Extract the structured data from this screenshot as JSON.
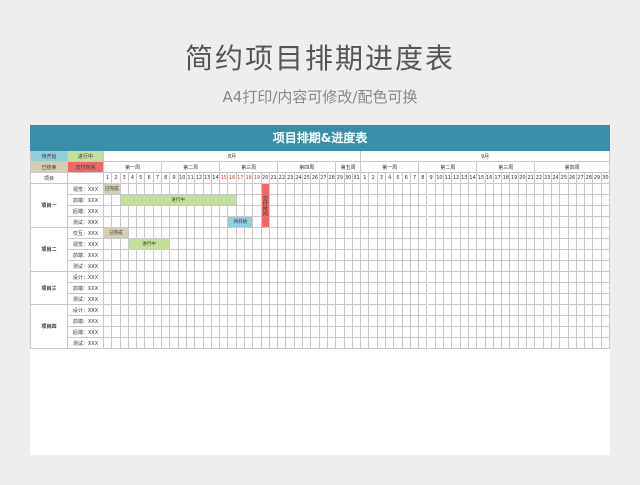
{
  "page": {
    "title": "简约项目排期进度表",
    "subtitle": "A4打印/内容可修改/配色可换"
  },
  "sheet": {
    "title": "项目排期&进度表",
    "colors": {
      "header": "#3a8fa8",
      "pending": "#92cddc",
      "in_progress": "#c4df9b",
      "done": "#d6ceb0",
      "delivery": "#ee6a6a"
    },
    "legend": [
      {
        "label": "待开始",
        "status": "pending"
      },
      {
        "label": "进行中",
        "status": "in_progress"
      },
      {
        "label": "已结束",
        "status": "done"
      },
      {
        "label": "交付时间",
        "status": "delivery"
      }
    ],
    "project_col_label": "项目",
    "months": [
      {
        "label": "8月",
        "start_day": 1,
        "days": 31
      },
      {
        "label": "9月",
        "start_day": 1,
        "days": 30
      }
    ],
    "weeks": [
      {
        "label": "第一周",
        "span": 7
      },
      {
        "label": "第二周",
        "span": 7
      },
      {
        "label": "第三周",
        "span": 7
      },
      {
        "label": "第四周",
        "span": 7
      },
      {
        "label": "第五周",
        "span": 3
      },
      {
        "label": "第一周",
        "span": 7
      },
      {
        "label": "第二周",
        "span": 7
      },
      {
        "label": "第三周",
        "span": 7
      },
      {
        "label": "第四周",
        "span": 9
      }
    ],
    "days": [
      "1",
      "2",
      "3",
      "4",
      "5",
      "6",
      "7",
      "8",
      "9",
      "10",
      "11",
      "12",
      "13",
      "14",
      "15",
      "16",
      "17",
      "18",
      "19",
      "20",
      "21",
      "22",
      "23",
      "24",
      "25",
      "26",
      "27",
      "28",
      "29",
      "30",
      "31",
      "1",
      "2",
      "3",
      "4",
      "5",
      "6",
      "7",
      "8",
      "9",
      "10",
      "11",
      "12",
      "13",
      "14",
      "15",
      "16",
      "17",
      "18",
      "19",
      "20",
      "21",
      "22",
      "23",
      "24",
      "25",
      "26",
      "27",
      "28",
      "29",
      "30"
    ],
    "red_days": [
      14,
      15,
      16,
      17,
      18
    ],
    "projects": [
      {
        "name": "项目一",
        "tasks": [
          "视觉：XXX",
          "前端：XXX",
          "后端：XXX",
          "测试：XXX"
        ]
      },
      {
        "name": "项目二",
        "tasks": [
          "交互：XXX",
          "视觉：XXX",
          "前端：XXX",
          "测试：XXX"
        ]
      },
      {
        "name": "项目三",
        "tasks": [
          "设计：XXX",
          "前端：XXX",
          "测试：XXX"
        ]
      },
      {
        "name": "项目四",
        "tasks": [
          "设计：XXX",
          "前端：XXX",
          "后端：XXX",
          "测试：XXX"
        ]
      }
    ],
    "bars": [
      {
        "row": 0,
        "start": 0,
        "span": 2,
        "label": "已完成",
        "status": "done"
      },
      {
        "row": 1,
        "start": 2,
        "span": 14,
        "label": "进行中",
        "status": "in_progress"
      },
      {
        "row": 3,
        "start": 15,
        "span": 3,
        "label": "待开始",
        "status": "pending"
      },
      {
        "row": 0,
        "start": 19,
        "span": 1,
        "row_span": 4,
        "label": "交付时间",
        "status": "delivery"
      },
      {
        "row": 4,
        "start": 0,
        "span": 3,
        "label": "已完成",
        "status": "done"
      },
      {
        "row": 5,
        "start": 3,
        "span": 5,
        "label": "进行中",
        "status": "in_progress"
      }
    ]
  }
}
